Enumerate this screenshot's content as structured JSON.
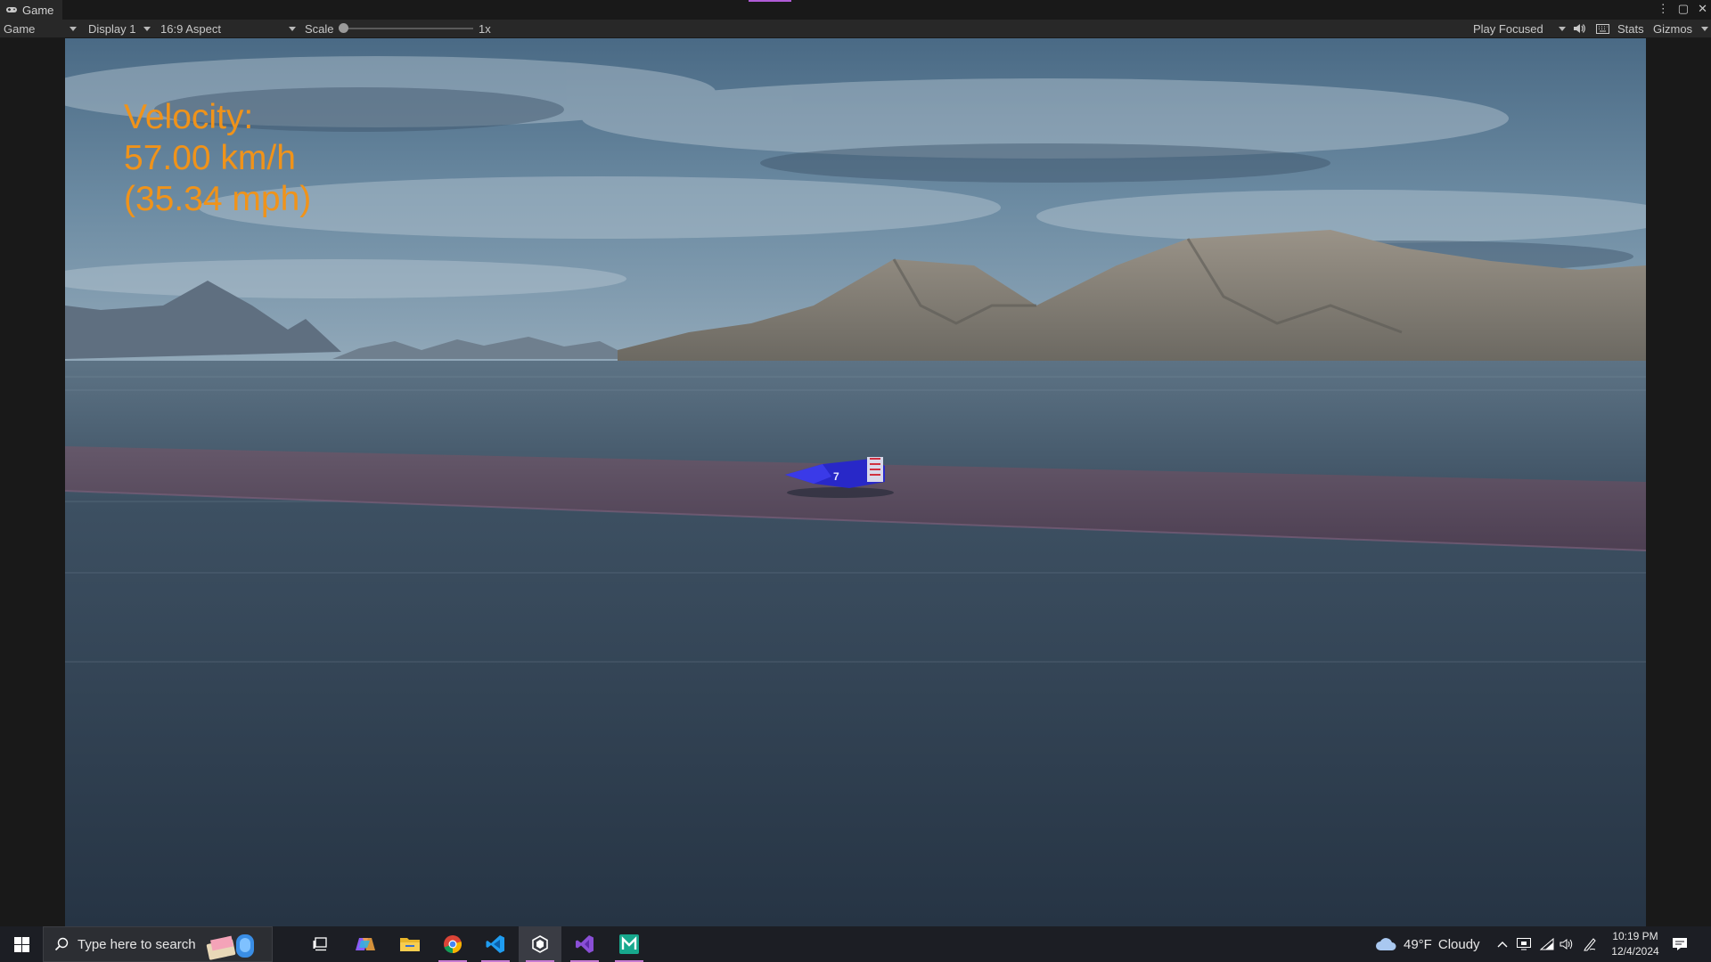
{
  "tab": {
    "icon": "gamepad-icon",
    "label": "Game"
  },
  "window_controls": {
    "more": "⋮",
    "maximize": "▢",
    "close": "✕"
  },
  "toolbar": {
    "view_select": "Game",
    "display_select": "Display 1",
    "aspect_select": "16:9 Aspect",
    "scale_label": "Scale",
    "scale_value": "1x",
    "play_mode_select": "Play Focused",
    "stats_label": "Stats",
    "gizmos_label": "Gizmos"
  },
  "hud": {
    "velocity_label": "Velocity:",
    "kmh": "57.00 km/h",
    "mph": "(35.34 mph)"
  },
  "taskbar": {
    "search_placeholder": "Type here to search",
    "apps": [
      "task-view-icon",
      "copilot-icon",
      "file-explorer-icon",
      "chrome-icon",
      "vscode-icon",
      "unity-icon",
      "visual-studio-icon",
      "app-m-icon"
    ],
    "weather_temp": "49°F",
    "weather_desc": "Cloudy",
    "time": "10:19 PM",
    "date": "12/4/2024"
  },
  "colors": {
    "hud_text": "#f0931a",
    "accent": "#c77bd3",
    "road": "#5b4a5c",
    "water": "#2f3e4e"
  }
}
